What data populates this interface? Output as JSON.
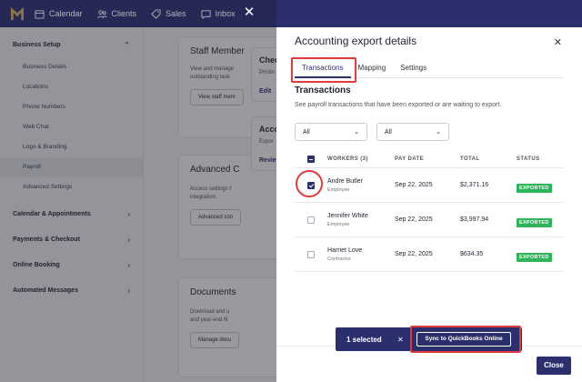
{
  "topnav": {
    "items": [
      {
        "label": "Calendar",
        "icon": "calendar-icon"
      },
      {
        "label": "Clients",
        "icon": "clients-icon"
      },
      {
        "label": "Sales",
        "icon": "tag-icon"
      },
      {
        "label": "Inbox",
        "icon": "chat-icon"
      }
    ]
  },
  "sidebar": {
    "business_setup": "Business Setup",
    "items": [
      "Business Details",
      "Locations",
      "Phone Numbers",
      "Web Chat",
      "Logo & Branding",
      "Payroll",
      "Advanced Settings"
    ],
    "active_item": "Payroll",
    "groups": [
      "Calendar & Appointments",
      "Payments & Checkout",
      "Online Booking",
      "Automated Messages"
    ]
  },
  "middle": {
    "staff_title": "Staff Member",
    "staff_desc_1": "View and manage",
    "staff_desc_2": "outstanding task",
    "staff_btn": "View staff mem",
    "advanced_title": "Advanced C",
    "advanced_desc_1": "Access settings f",
    "advanced_desc_2": "integration.",
    "advanced_btn": "Advanced con",
    "documents_title": "Documents",
    "documents_desc_1": "Download and u",
    "documents_desc_2": "and year-end fil",
    "documents_btn": "Manage docu",
    "check_title": "Chec",
    "check_desc": "Printin",
    "check_link": "Edit",
    "acc_title": "Acco",
    "acc_desc": "Expor",
    "acc_link": "Revie"
  },
  "panel": {
    "title": "Accounting export details",
    "tabs": [
      "Transactions",
      "Mapping",
      "Settings"
    ],
    "active_tab": "Transactions",
    "section_title": "Transactions",
    "section_desc": "See payroll transactions that have been exported or are waiting to export.",
    "filter_1": "All",
    "filter_2": "All",
    "columns": {
      "workers": "WORKERS (3)",
      "pay_date": "PAY DATE",
      "total": "TOTAL",
      "status": "STATUS"
    },
    "rows": [
      {
        "name": "Andre Butler",
        "role": "Employee",
        "date": "Sep 22, 2025",
        "total": "$2,371.16",
        "status": "EXPORTED",
        "checked": true
      },
      {
        "name": "Jennifer White",
        "role": "Employee",
        "date": "Sep 22, 2025",
        "total": "$3,997.94",
        "status": "EXPORTED",
        "checked": false
      },
      {
        "name": "Harriet Love",
        "role": "Contractor",
        "date": "Sep 22, 2025",
        "total": "$634.35",
        "status": "EXPORTED",
        "checked": false
      }
    ],
    "bulk_count": "1 selected",
    "sync_label": "Sync to QuickBooks Online",
    "close_label": "Close"
  },
  "colors": {
    "brand": "#2b2f6e",
    "success": "#2fb35b",
    "highlight": "#e03a3a"
  }
}
